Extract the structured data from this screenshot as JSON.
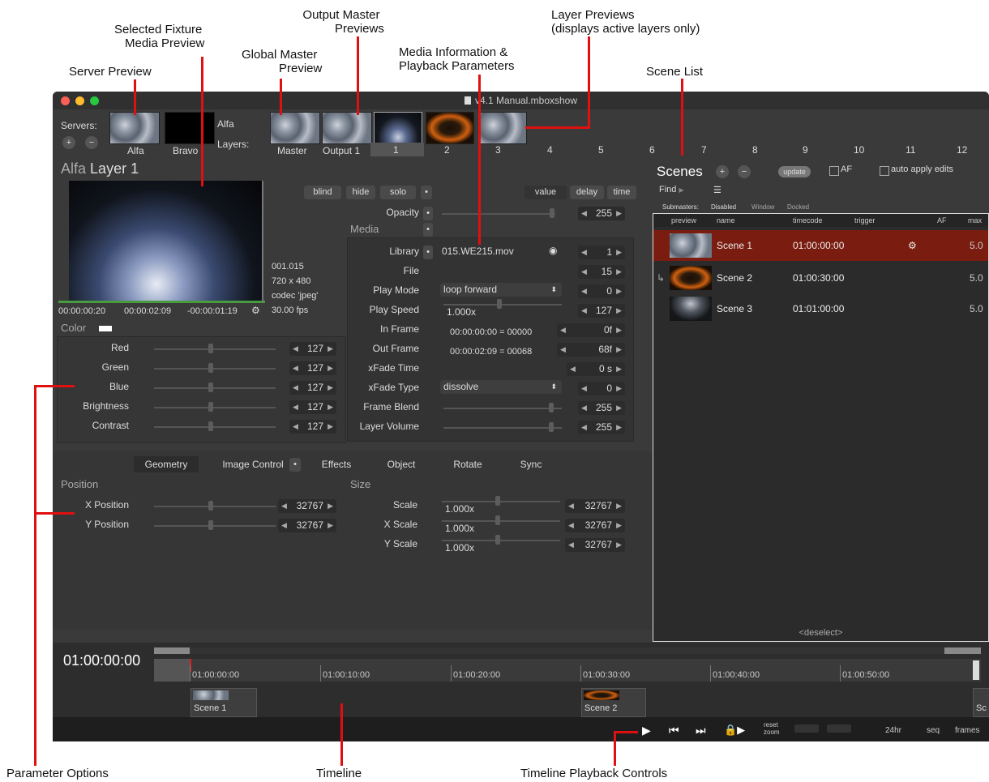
{
  "annotations": {
    "server_preview": "Server Preview",
    "selected_fixture_1": "Selected Fixture",
    "selected_fixture_2": "Media Preview",
    "global_master_1": "Global Master",
    "global_master_2": "Preview",
    "output_master_1": "Output Master",
    "output_master_2": "Previews",
    "media_info_1": "Media Information &",
    "media_info_2": "Playback Parameters",
    "layer_previews_1": "Layer Previews",
    "layer_previews_2": "(displays active layers only)",
    "scene_list": "Scene List",
    "parameter_options": "Parameter Options",
    "timeline": "Timeline",
    "timeline_controls": "Timeline Playback Controls"
  },
  "window": {
    "title": "v4.1 Manual.mboxshow",
    "servers_label": "Servers:",
    "layers_label": "Layers:",
    "server_name": "Alfa",
    "servers": [
      "Alfa",
      "Bravo"
    ],
    "masters": [
      "Master",
      "Output 1"
    ],
    "layer_numbers": [
      "1",
      "2",
      "3",
      "4",
      "5",
      "6",
      "7",
      "8",
      "9",
      "10",
      "11",
      "12"
    ]
  },
  "layer_panel": {
    "title_server": "Alfa",
    "title_layer": "Layer 1",
    "buttons": {
      "blind": "blind",
      "hide": "hide",
      "solo": "solo"
    },
    "modes": {
      "value": "value",
      "delay": "delay",
      "time": "time"
    },
    "opacity_label": "Opacity",
    "opacity_value": "255",
    "media_heading": "Media",
    "media_info": {
      "file_id": "001.015",
      "resolution": "720 x 480",
      "codec": "codec 'jpeg'",
      "fps": "30.00 fps"
    },
    "preview_times": {
      "current": "00:00:00:20",
      "duration": "00:00:02:09",
      "remaining": "-00:00:01:19"
    },
    "color_heading": "Color",
    "color_params": [
      {
        "label": "Red",
        "value": "127"
      },
      {
        "label": "Green",
        "value": "127"
      },
      {
        "label": "Blue",
        "value": "127"
      },
      {
        "label": "Brightness",
        "value": "127"
      },
      {
        "label": "Contrast",
        "value": "127"
      }
    ],
    "media_params": {
      "library": {
        "label": "Library",
        "text": "015.WE215.mov",
        "value": "1"
      },
      "file": {
        "label": "File",
        "value": "15"
      },
      "play_mode": {
        "label": "Play Mode",
        "text": "loop forward",
        "value": "0"
      },
      "play_speed": {
        "label": "Play Speed",
        "text": "1.000x",
        "value": "127"
      },
      "in_frame": {
        "label": "In Frame",
        "text": "00:00:00:00 = 00000",
        "value": "0f"
      },
      "out_frame": {
        "label": "Out Frame",
        "text": "00:00:02:09 = 00068",
        "value": "68f"
      },
      "xfade_time": {
        "label": "xFade Time",
        "value": "0 s"
      },
      "xfade_type": {
        "label": "xFade Type",
        "text": "dissolve",
        "value": "0"
      },
      "frame_blend": {
        "label": "Frame Blend",
        "value": "255"
      },
      "layer_volume": {
        "label": "Layer Volume",
        "value": "255"
      }
    },
    "tabs": [
      "Geometry",
      "Image Control",
      "Effects",
      "Object",
      "Rotate",
      "Sync"
    ],
    "position_heading": "Position",
    "size_heading": "Size",
    "position_params": [
      {
        "label": "X Position",
        "value": "32767"
      },
      {
        "label": "Y Position",
        "value": "32767"
      }
    ],
    "size_params": [
      {
        "label": "Scale",
        "text": "1.000x",
        "value": "32767"
      },
      {
        "label": "X Scale",
        "text": "1.000x",
        "value": "32767"
      },
      {
        "label": "Y Scale",
        "text": "1.000x",
        "value": "32767"
      }
    ]
  },
  "scenes": {
    "title": "Scenes",
    "update": "update",
    "af": "AF",
    "auto_apply": "auto apply edits",
    "find": "Find",
    "submasters": "Submasters:",
    "sub_disabled": "Disabled",
    "sub_window": "Window",
    "sub_docked": "Docked",
    "columns": [
      "preview",
      "name",
      "timecode",
      "trigger",
      "AF",
      "max"
    ],
    "rows": [
      {
        "name": "Scene 1",
        "timecode": "01:00:00:00",
        "max": "5.0"
      },
      {
        "name": "Scene 2",
        "timecode": "01:00:30:00",
        "max": "5.0"
      },
      {
        "name": "Scene 3",
        "timecode": "01:01:00:00",
        "max": "5.0"
      }
    ],
    "deselect": "<deselect>"
  },
  "timeline": {
    "current_time": "01:00:00:00",
    "ticks": [
      "01:00:00:00",
      "01:00:10:00",
      "01:00:20:00",
      "01:00:30:00",
      "01:00:40:00",
      "01:00:50:00"
    ],
    "clips": [
      "Scene 1",
      "Scene 2",
      "Sc"
    ],
    "reset_zoom_1": "reset",
    "reset_zoom_2": "zoom",
    "hr24": "24hr",
    "seq": "seq",
    "frames": "frames"
  }
}
